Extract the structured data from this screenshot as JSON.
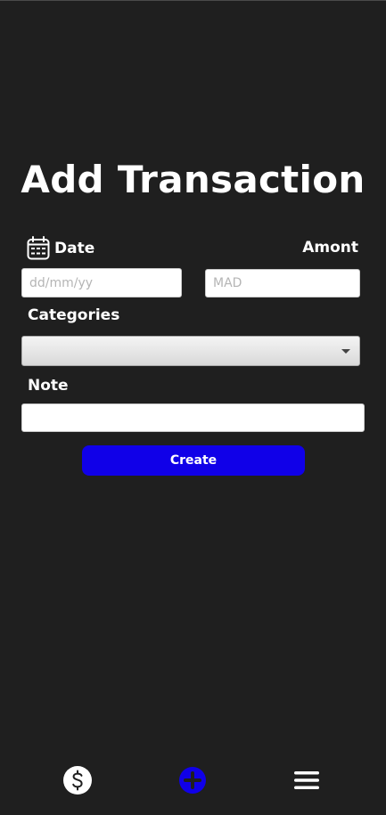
{
  "page": {
    "title": "Add Transaction"
  },
  "form": {
    "date_label": "Date",
    "date_placeholder": "dd/mm/yy",
    "date_value": "",
    "amount_label": "Amont",
    "amount_placeholder": "MAD",
    "amount_value": "",
    "categories_label": "Categories",
    "categories_selected": "",
    "note_label": "Note",
    "note_value": "",
    "create_label": "Create"
  },
  "nav": {
    "items": [
      {
        "icon": "dollar-circle-icon"
      },
      {
        "icon": "plus-circle-icon",
        "active": true
      },
      {
        "icon": "hamburger-menu-icon"
      }
    ]
  },
  "colors": {
    "background": "#1f1f1f",
    "text": "#ffffff",
    "accent": "#1000e8"
  }
}
